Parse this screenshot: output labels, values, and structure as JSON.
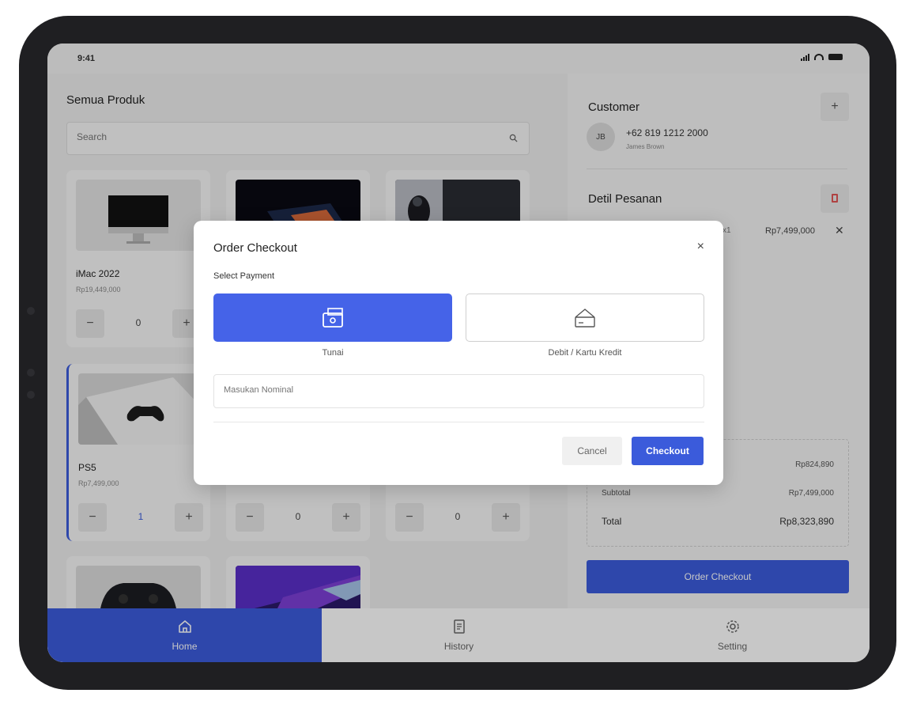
{
  "status_bar": {
    "time": "9:41"
  },
  "products": {
    "title": "Semua Produk",
    "search_placeholder": "Search",
    "items": [
      {
        "name": "iMac 2022",
        "price": "Rp19,449,000",
        "qty": "0"
      },
      {
        "name": "",
        "price": "",
        "qty": ""
      },
      {
        "name": "",
        "price": "",
        "qty": ""
      },
      {
        "name": "PS5",
        "price": "Rp7,499,000",
        "qty": "1"
      },
      {
        "name": "",
        "price": "",
        "qty": "0"
      },
      {
        "name": "",
        "price": "",
        "qty": "0"
      }
    ],
    "stepper": {
      "minus": "−",
      "plus": "+"
    }
  },
  "customer": {
    "title": "Customer",
    "add_label": "+",
    "initials": "JB",
    "phone": "+62 819 1212 2000",
    "name": "James Brown"
  },
  "order": {
    "title": "Detil Pesanan",
    "line": {
      "qty": "x1",
      "price": "Rp7,499,000",
      "remove": "✕"
    },
    "summary": [
      {
        "label": "",
        "value": "Rp824,890"
      },
      {
        "label": "Subtotal",
        "value": "Rp7,499,000"
      },
      {
        "label": "Total",
        "value": "Rp8,323,890"
      }
    ],
    "checkout_label": "Order Checkout"
  },
  "nav": {
    "items": [
      {
        "label": "Home",
        "icon": "home-icon",
        "active": true
      },
      {
        "label": "History",
        "icon": "receipt-icon",
        "active": false
      },
      {
        "label": "Setting",
        "icon": "gear-icon",
        "active": false
      }
    ]
  },
  "modal": {
    "title": "Order Checkout",
    "close": "×",
    "subtitle": "Select Payment",
    "options": [
      {
        "label": "Tunai",
        "icon": "cash-icon",
        "selected": true
      },
      {
        "label": "Debit / Kartu Kredit",
        "icon": "card-wallet-icon",
        "selected": false
      }
    ],
    "nominal_placeholder": "Masukan Nominal",
    "cancel_label": "Cancel",
    "checkout_label": "Checkout"
  },
  "colors": {
    "accent": "#3b5bdb",
    "danger": "#e05555"
  }
}
